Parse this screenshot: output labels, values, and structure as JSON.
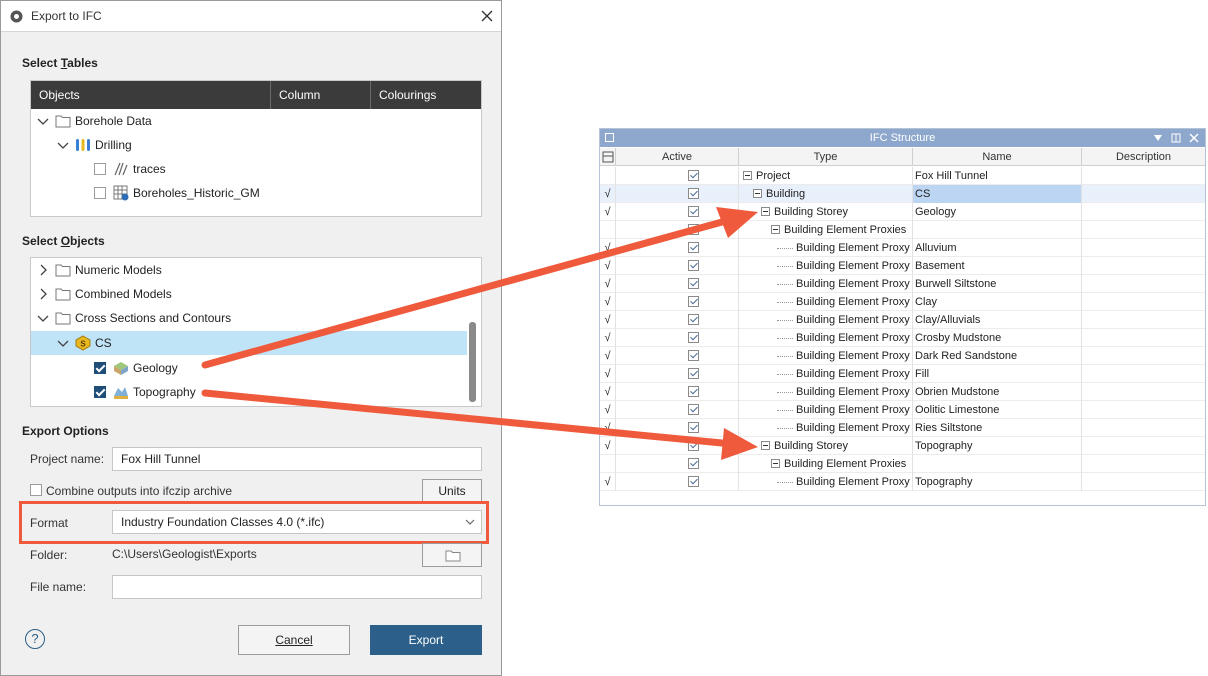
{
  "dialog": {
    "title": "Export to IFC",
    "select_tables_prefix": "Select ",
    "select_tables_u": "T",
    "select_tables_suffix": "ables",
    "table_columns": [
      "Objects",
      "Column",
      "Colourings"
    ],
    "tables_tree": [
      {
        "label": "Borehole Data",
        "icon": "folder-icon"
      },
      {
        "label": "Drilling",
        "icon": "drilling-icon"
      },
      {
        "label": "traces",
        "icon": "traces-icon",
        "checked": false
      },
      {
        "label": "Boreholes_Historic_GM",
        "icon": "table-icon",
        "checked": false
      }
    ],
    "select_objects_prefix": "Select ",
    "select_objects_u": "O",
    "select_objects_suffix": "bjects",
    "objects_tree": [
      {
        "label": "Numeric Models",
        "icon": "folder-icon"
      },
      {
        "label": "Combined Models",
        "icon": "folder-icon"
      },
      {
        "label": "Cross Sections and Contours",
        "icon": "folder-icon"
      },
      {
        "label": "CS",
        "icon": "cross-section-icon"
      },
      {
        "label": "Geology",
        "icon": "geology-icon",
        "checked": true
      },
      {
        "label": "Topography",
        "icon": "topography-icon",
        "checked": true
      }
    ],
    "export_options": "Export Options",
    "project_name_label": "Project name:",
    "project_name_value": "Fox Hill Tunnel",
    "combine_label": "Combine outputs into ifczip archive",
    "units_button": "Units",
    "format_label": "Format",
    "format_value": "Industry Foundation Classes 4.0 (*.ifc)",
    "folder_label": "Folder:",
    "folder_value": "C:\\Users\\Geologist\\Exports",
    "file_name_label": "File name:",
    "help": "?",
    "cancel_button": "Cancel",
    "export_button": "Export"
  },
  "ifc_structure": {
    "title": "IFC Structure",
    "columns": [
      "Active",
      "Type",
      "Name",
      "Description"
    ],
    "rows": [
      {
        "flag": "",
        "type": "Project",
        "name": "Fox Hill Tunnel",
        "level": 0
      },
      {
        "flag": "√",
        "type": "Building",
        "name": "CS",
        "level": 1,
        "selected": true
      },
      {
        "flag": "√",
        "type": "Building Storey",
        "name": "Geology",
        "level": 2
      },
      {
        "flag": "",
        "type": "Building Element Proxies",
        "name": "",
        "level": 3
      },
      {
        "flag": "√",
        "type": "Building Element Proxy",
        "name": "Alluvium",
        "level": 4
      },
      {
        "flag": "√",
        "type": "Building Element Proxy",
        "name": "Basement",
        "level": 4
      },
      {
        "flag": "√",
        "type": "Building Element Proxy",
        "name": "Burwell Siltstone",
        "level": 4
      },
      {
        "flag": "√",
        "type": "Building Element Proxy",
        "name": "Clay",
        "level": 4
      },
      {
        "flag": "√",
        "type": "Building Element Proxy",
        "name": "Clay/Alluvials",
        "level": 4
      },
      {
        "flag": "√",
        "type": "Building Element Proxy",
        "name": "Crosby Mudstone",
        "level": 4
      },
      {
        "flag": "√",
        "type": "Building Element Proxy",
        "name": "Dark Red Sandstone",
        "level": 4
      },
      {
        "flag": "√",
        "type": "Building Element Proxy",
        "name": "Fill",
        "level": 4
      },
      {
        "flag": "√",
        "type": "Building Element Proxy",
        "name": "Obrien Mudstone",
        "level": 4
      },
      {
        "flag": "√",
        "type": "Building Element Proxy",
        "name": "Oolitic Limestone",
        "level": 4
      },
      {
        "flag": "√",
        "type": "Building Element Proxy",
        "name": "Ries Siltstone",
        "level": 4
      },
      {
        "flag": "√",
        "type": "Building Storey",
        "name": "Topography",
        "level": 2
      },
      {
        "flag": "",
        "type": "Building Element Proxies",
        "name": "",
        "level": 3
      },
      {
        "flag": "√",
        "type": "Building Element Proxy",
        "name": "Topography",
        "level": 4
      }
    ]
  },
  "colors": {
    "accent": "#2c5f8a",
    "highlight_box": "#f05a3c",
    "arrow": "#f05a3c",
    "selection": "#bfe3f7",
    "ifc_title_bar": "#8da8cc"
  }
}
